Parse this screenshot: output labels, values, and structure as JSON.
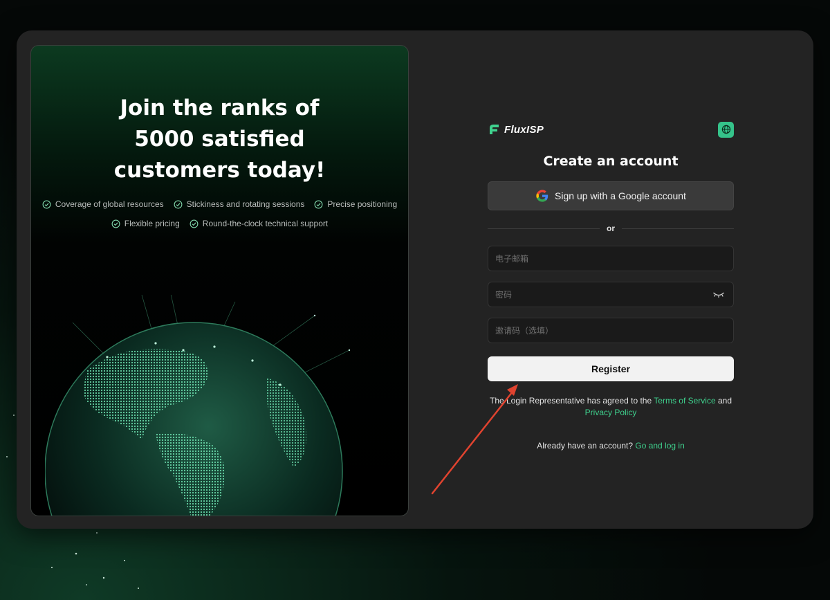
{
  "hero": {
    "title": "Join the ranks of 5000 satisfied customers today!",
    "features_row1": [
      "Coverage of global resources",
      "Stickiness and rotating sessions",
      "Precise positioning"
    ],
    "features_row2": [
      "Flexible pricing",
      "Round-the-clock technical support"
    ]
  },
  "brand": {
    "name": "FluxISP",
    "accent_color": "#35c38a",
    "language_icon": "globe-icon"
  },
  "form": {
    "title": "Create an account",
    "google_label": "Sign up with a Google account",
    "divider": "or",
    "email_placeholder": "电子邮箱",
    "password_placeholder": "密码",
    "invite_placeholder": "邀请码（选填）",
    "register_label": "Register",
    "terms_prefix": "The Login Representative has agreed to the",
    "terms_link": "Terms of Service",
    "terms_and": "and",
    "privacy_link": "Privacy Policy",
    "login_prompt": "Already have an account?",
    "login_link": "Go and log in"
  },
  "colors": {
    "link": "#3fd28e",
    "annotation_arrow": "#e0432f"
  }
}
